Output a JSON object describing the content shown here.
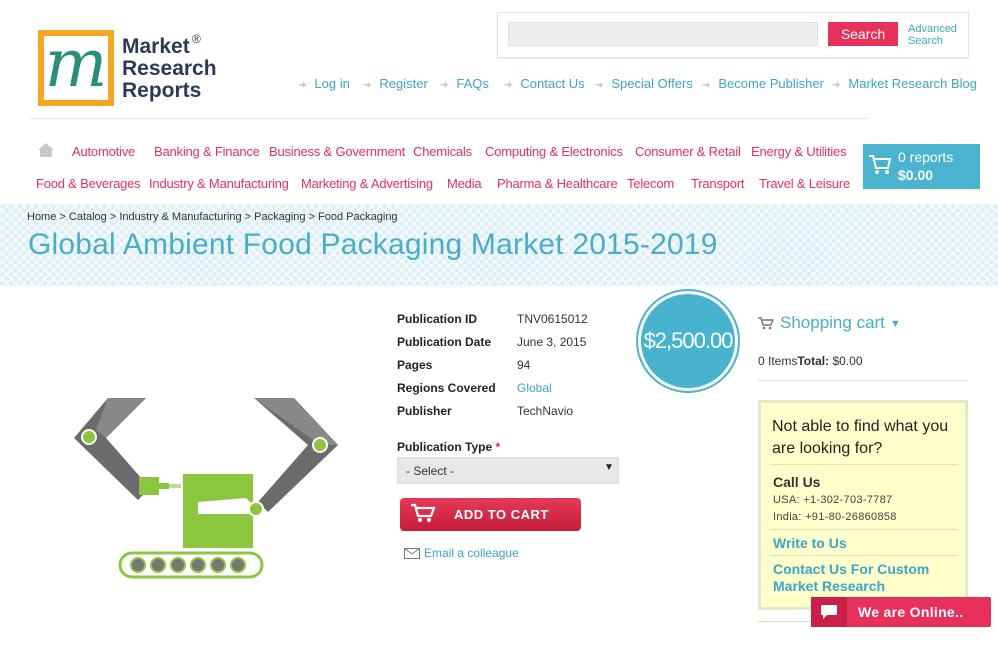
{
  "logo": {
    "letter": "m",
    "line1": "Market",
    "line2": "Research",
    "line3": "Reports",
    "reg": "®"
  },
  "search": {
    "placeholder": "",
    "button": "Search",
    "advanced_line1": "Advanced",
    "advanced_line2": "Search"
  },
  "top_links": [
    "Log in",
    "Register",
    "FAQs",
    "Contact Us",
    "Special Offers",
    "Become Publisher",
    "Market Research Blog"
  ],
  "categories_row1": [
    "Automotive",
    "Banking & Finance",
    "Business & Government",
    "Chemicals",
    "Computing & Electronics",
    "Consumer & Retail",
    "Energy & Utilities"
  ],
  "categories_row2": [
    "Food & Beverages",
    "Industry & Manufacturing",
    "Marketing & Advertising",
    "Media",
    "Pharma & Healthcare",
    "Telecom",
    "Transport",
    "Travel & Leisure"
  ],
  "cart": {
    "count": "0 reports",
    "total": "$0.00"
  },
  "breadcrumb": "Home > Catalog > Industry & Manufacturing > Packaging > Food Packaging",
  "page_title": "Global Ambient Food Packaging Market 2015-2019",
  "details": [
    {
      "label": "Publication ID",
      "value": "TNV0615012"
    },
    {
      "label": "Publication Date",
      "value": "June 3, 2015"
    },
    {
      "label": "Pages",
      "value": "94"
    },
    {
      "label": "Regions Covered",
      "value": "Global"
    },
    {
      "label": "Publisher",
      "value": "TechNavio"
    }
  ],
  "price": "$2,500.00",
  "publication_type": {
    "label": "Publication Type",
    "required": "*",
    "selected": "- Select -"
  },
  "add_to_cart": "ADD TO CART",
  "email_colleague": "Email a colleague",
  "shopping_cart": {
    "title": "Shopping cart",
    "items_label": "0 Items",
    "total_label": "Total:",
    "total_value": "$0.00"
  },
  "help": {
    "title": "Not able to find what you are looking for?",
    "call_us": "Call Us",
    "usa": "USA: +1-302-703-7787",
    "india": "India: +91-80-26860858",
    "write_us": "Write to Us",
    "custom": "Contact Us For Custom Market Research"
  },
  "chat": {
    "label": "We are Online.."
  },
  "colors": {
    "accent_pink": "#e7305a",
    "accent_blue": "#49adc9",
    "logo_orange": "#f5a623",
    "help_bg": "#ffffcc"
  }
}
